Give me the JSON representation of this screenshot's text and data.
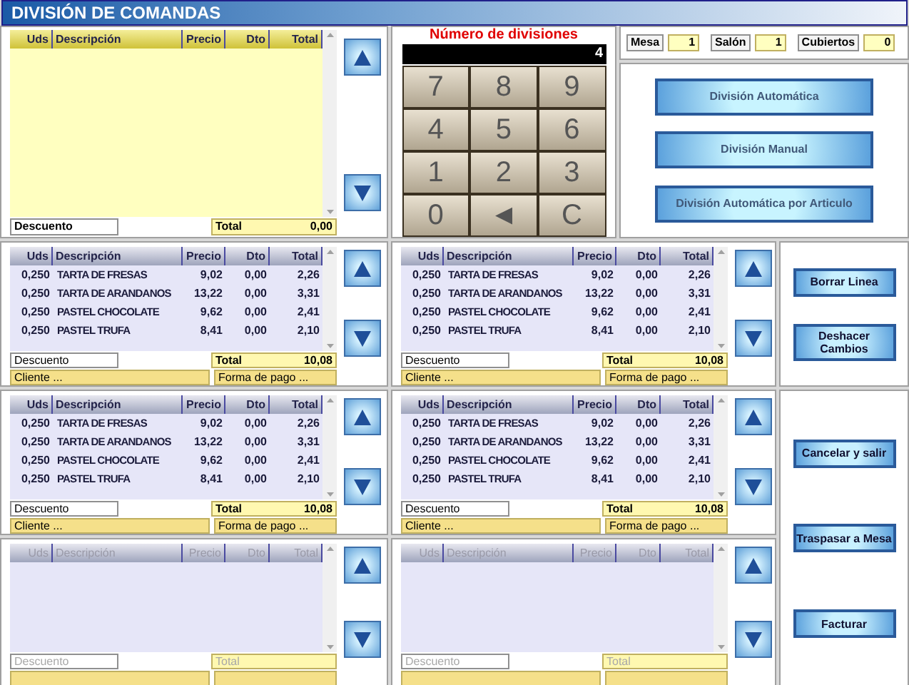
{
  "title": "DIVISIÓN DE COMANDAS",
  "main_table": {
    "columns": [
      "Uds",
      "Descripción",
      "Precio",
      "Dto",
      "Total"
    ],
    "discount_label": "Descuento",
    "total_label": "Total",
    "total_value": "0,00"
  },
  "keypad": {
    "title": "Número de divisiones",
    "display": "4",
    "keys": [
      "7",
      "8",
      "9",
      "4",
      "5",
      "6",
      "1",
      "2",
      "3",
      "0",
      "◄",
      "C"
    ]
  },
  "info": [
    {
      "label": "Mesa",
      "value": "1"
    },
    {
      "label": "Salón",
      "value": "1"
    },
    {
      "label": "Cubiertos",
      "value": "0"
    }
  ],
  "division_buttons": [
    "División Automática",
    "División Manual",
    "División Automática por Articulo"
  ],
  "panels": [
    {
      "disabled": false,
      "columns": [
        "Uds",
        "Descripción",
        "Precio",
        "Dto",
        "Total"
      ],
      "rows": [
        [
          "0,250",
          "TARTA DE FRESAS",
          "9,02",
          "0,00",
          "2,26"
        ],
        [
          "0,250",
          "TARTA DE ARANDANOS",
          "13,22",
          "0,00",
          "3,31"
        ],
        [
          "0,250",
          "PASTEL CHOCOLATE",
          "9,62",
          "0,00",
          "2,41"
        ],
        [
          "0,250",
          "PASTEL TRUFA",
          "8,41",
          "0,00",
          "2,10"
        ]
      ],
      "discount_label": "Descuento",
      "total_label": "Total",
      "total_value": "10,08",
      "client": "Cliente ...",
      "payment": "Forma de pago ..."
    },
    {
      "disabled": false,
      "columns": [
        "Uds",
        "Descripción",
        "Precio",
        "Dto",
        "Total"
      ],
      "rows": [
        [
          "0,250",
          "TARTA DE FRESAS",
          "9,02",
          "0,00",
          "2,26"
        ],
        [
          "0,250",
          "TARTA DE ARANDANOS",
          "13,22",
          "0,00",
          "3,31"
        ],
        [
          "0,250",
          "PASTEL CHOCOLATE",
          "9,62",
          "0,00",
          "2,41"
        ],
        [
          "0,250",
          "PASTEL TRUFA",
          "8,41",
          "0,00",
          "2,10"
        ]
      ],
      "discount_label": "Descuento",
      "total_label": "Total",
      "total_value": "10,08",
      "client": "Cliente ...",
      "payment": "Forma de pago ..."
    },
    {
      "disabled": false,
      "columns": [
        "Uds",
        "Descripción",
        "Precio",
        "Dto",
        "Total"
      ],
      "rows": [
        [
          "0,250",
          "TARTA DE FRESAS",
          "9,02",
          "0,00",
          "2,26"
        ],
        [
          "0,250",
          "TARTA DE ARANDANOS",
          "13,22",
          "0,00",
          "3,31"
        ],
        [
          "0,250",
          "PASTEL CHOCOLATE",
          "9,62",
          "0,00",
          "2,41"
        ],
        [
          "0,250",
          "PASTEL TRUFA",
          "8,41",
          "0,00",
          "2,10"
        ]
      ],
      "discount_label": "Descuento",
      "total_label": "Total",
      "total_value": "10,08",
      "client": "Cliente ...",
      "payment": "Forma de pago ..."
    },
    {
      "disabled": false,
      "columns": [
        "Uds",
        "Descripción",
        "Precio",
        "Dto",
        "Total"
      ],
      "rows": [
        [
          "0,250",
          "TARTA DE FRESAS",
          "9,02",
          "0,00",
          "2,26"
        ],
        [
          "0,250",
          "TARTA DE ARANDANOS",
          "13,22",
          "0,00",
          "3,31"
        ],
        [
          "0,250",
          "PASTEL CHOCOLATE",
          "9,62",
          "0,00",
          "2,41"
        ],
        [
          "0,250",
          "PASTEL TRUFA",
          "8,41",
          "0,00",
          "2,10"
        ]
      ],
      "discount_label": "Descuento",
      "total_label": "Total",
      "total_value": "10,08",
      "client": "Cliente ...",
      "payment": "Forma de pago ..."
    },
    {
      "disabled": true,
      "columns": [
        "Uds",
        "Descripción",
        "Precio",
        "Dto",
        "Total"
      ],
      "discount_label": "Descuento",
      "total_label": "Total"
    },
    {
      "disabled": true,
      "columns": [
        "Uds",
        "Descripción",
        "Precio",
        "Dto",
        "Total"
      ],
      "discount_label": "Descuento",
      "total_label": "Total"
    }
  ],
  "line_buttons": [
    "Borrar Linea",
    "Deshacer Cambios"
  ],
  "action_buttons": [
    "Cancelar y salir",
    "Traspasar a Mesa",
    "Facturar"
  ]
}
